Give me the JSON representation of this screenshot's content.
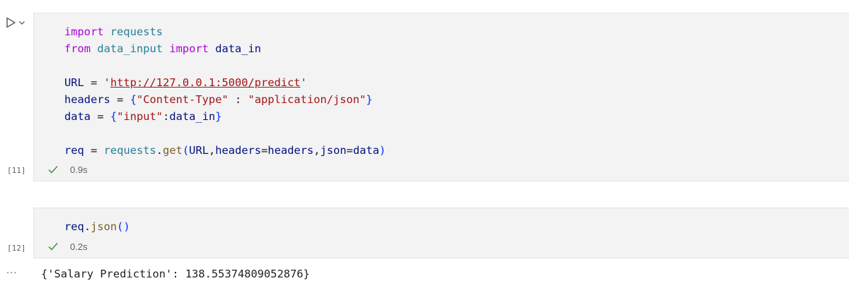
{
  "cells": [
    {
      "execution_count": "[11]",
      "status_time": "0.9s",
      "code": {
        "line1": {
          "kw": "import",
          "mod": "requests"
        },
        "line2": {
          "kw_from": "from",
          "mod": "data_input",
          "kw_import": "import",
          "name": "data_in"
        },
        "line4": {
          "var": "URL",
          "eq": "=",
          "q_open": "'",
          "url": "http://127.0.0.1:5000/predict",
          "q_close": "'"
        },
        "line5": {
          "var": "headers",
          "eq": "=",
          "brace_open": "{",
          "key": "\"Content-Type\"",
          "colon": " : ",
          "val": "\"application/json\"",
          "brace_close": "}"
        },
        "line6": {
          "var": "data",
          "eq": "=",
          "brace_open": "{",
          "key": "\"input\"",
          "colon": ":",
          "val": "data_in",
          "brace_close": "}"
        },
        "line8": {
          "var": "req",
          "eq": "=",
          "mod": "requests",
          "dot": ".",
          "fn": "get",
          "paren_open": "(",
          "arg1": "URL",
          "comma1": ",",
          "kw1": "headers",
          "eq1": "=",
          "v1": "headers",
          "comma2": ",",
          "kw2": "json",
          "eq2": "=",
          "v2": "data",
          "paren_close": ")"
        }
      }
    },
    {
      "execution_count": "[12]",
      "status_time": "0.2s",
      "code": {
        "line1": {
          "var": "req",
          "dot": ".",
          "fn": "json",
          "parens": "()"
        }
      }
    }
  ],
  "output": {
    "ellipsis": "...",
    "text": "{'Salary Prediction': 138.55374809052876}"
  },
  "colors": {
    "keyword": "#af00db",
    "module": "#267f99",
    "variable": "#001080",
    "function": "#795e26",
    "string": "#a31515",
    "success_check": "#388a34",
    "cell_background": "#f3f3f3"
  },
  "icons": {
    "run": "run-icon",
    "chevron": "chevron-down-icon",
    "check": "check-icon"
  }
}
